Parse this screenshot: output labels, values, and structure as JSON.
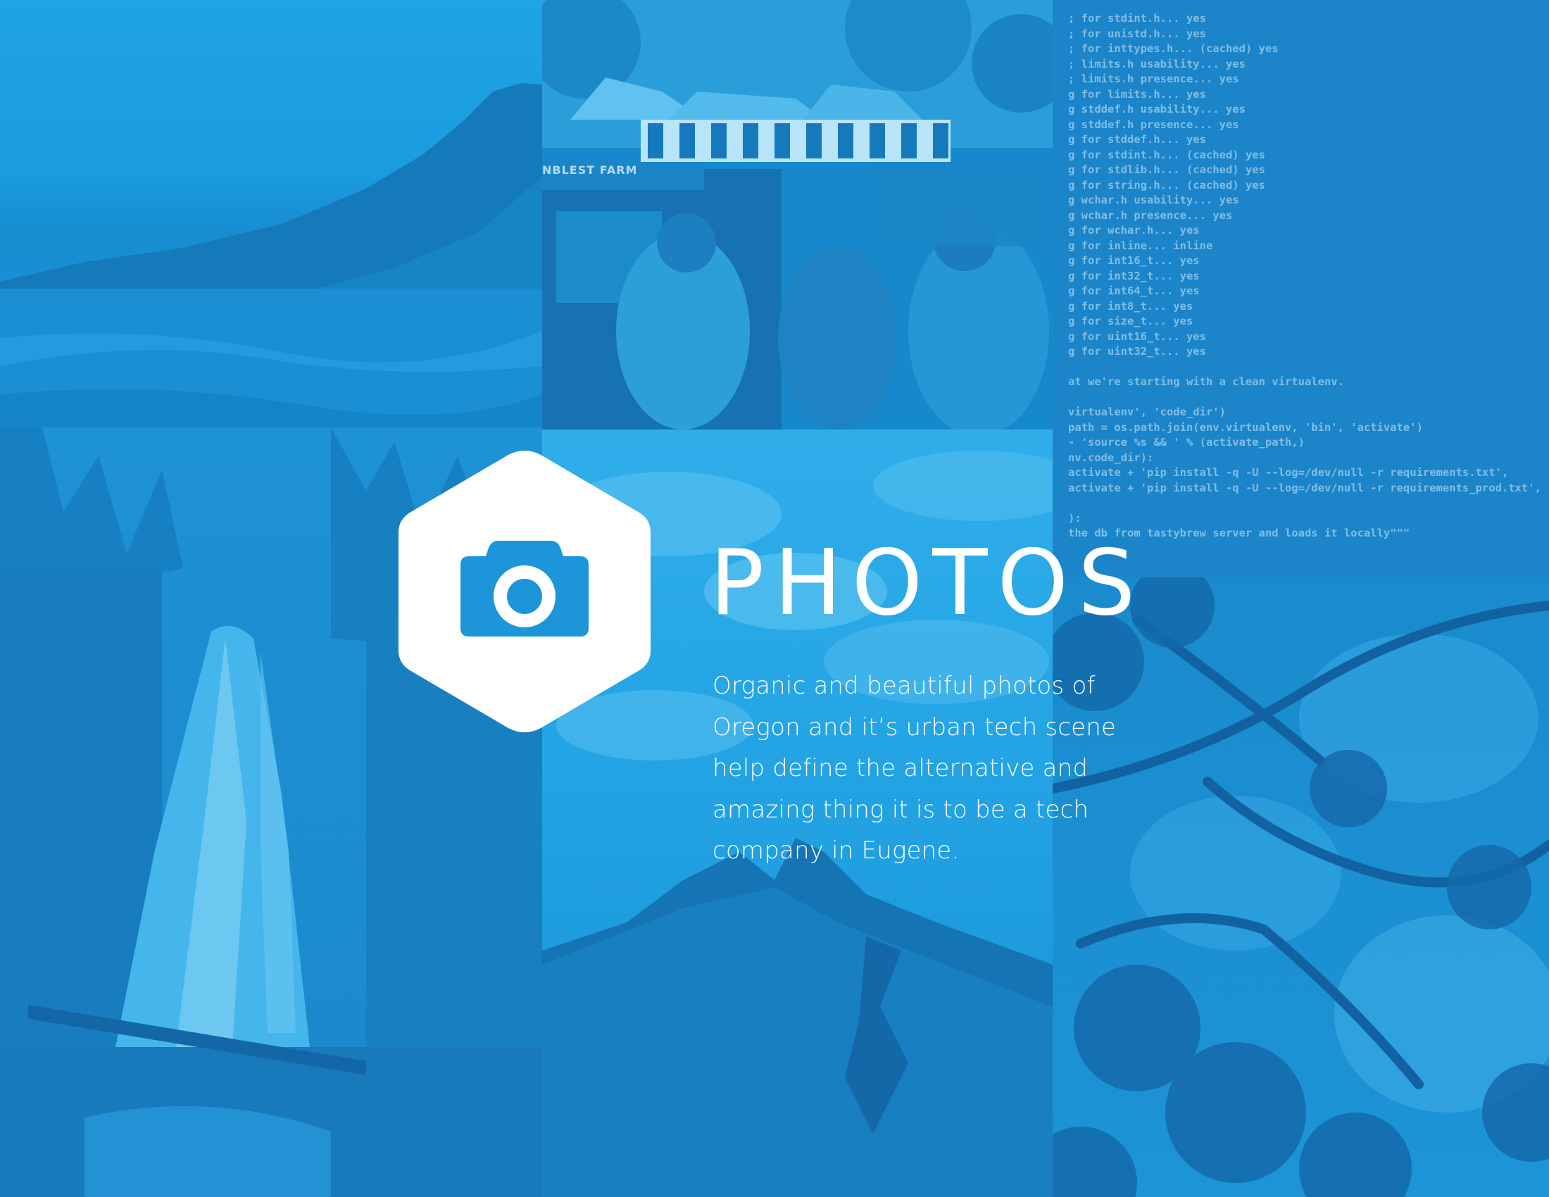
{
  "page": {
    "title": "PHOTOS",
    "description": "Organic and beautiful photos of Oregon and it’s urban tech scene help define the alternative and amazing thing it is to be a tech company in Eugene.",
    "accent_color": "#1a9ee0",
    "text_color": "#ffffff"
  },
  "logo": {
    "icon": "camera-icon",
    "shape": "hexagon"
  },
  "photo_tiles": {
    "market_sign": "NBLEST FARM",
    "code_lines": [
      "; for stdint.h... yes",
      "; for unistd.h... yes",
      "; for inttypes.h... (cached) yes",
      "; limits.h usability... yes",
      "; limits.h presence... yes",
      "g for limits.h... yes",
      "g stddef.h usability... yes",
      "g stddef.h presence... yes",
      "g for stddef.h... yes",
      "g for stdint.h... (cached) yes",
      "g for stdlib.h... (cached) yes",
      "g for string.h... (cached) yes",
      "g wchar.h usability... yes",
      "g wchar.h presence... yes",
      "g for wchar.h... yes",
      "g for inline... inline",
      "g for int16_t... yes",
      "g for int32_t... yes",
      "g for int64_t... yes",
      "g for int8_t... yes",
      "g for size_t... yes",
      "g for uint16_t... yes",
      "g for uint32_t... yes",
      "",
      "at we're starting with a clean virtualenv.",
      "",
      "virtualenv', 'code_dir')",
      "path = os.path.join(env.virtualenv, 'bin', 'activate')",
      "- 'source %s && ' % (activate_path,)",
      "nv.code_dir):",
      "activate + 'pip install -q -U --log=/dev/null -r requirements.txt',",
      "activate + 'pip install -q -U --log=/dev/null -r requirements_prod.txt',",
      "",
      "):",
      "the db from tastybrew server and loads it locally\"\"\""
    ]
  }
}
